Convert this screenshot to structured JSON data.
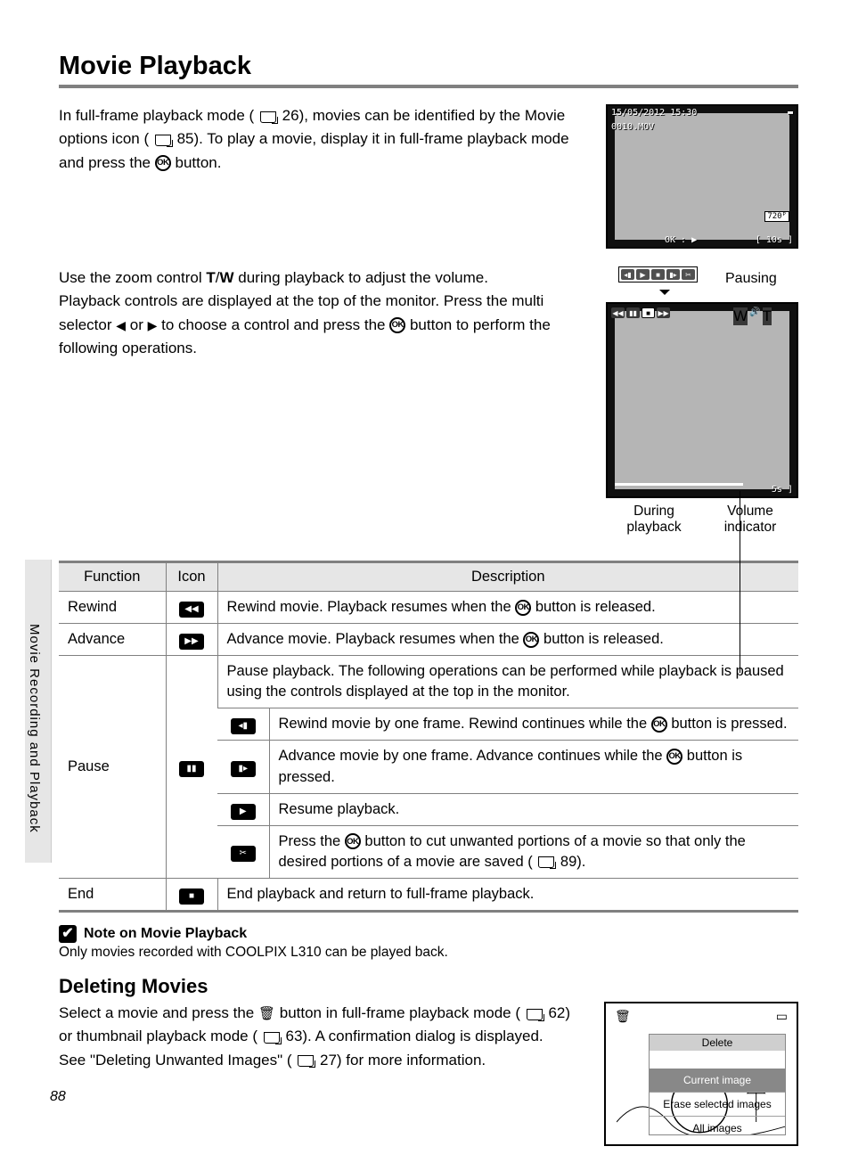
{
  "heading": "Movie Playback",
  "page_number": "88",
  "side_label": "Movie Recording and Playback",
  "intro": {
    "p1a": "In full-frame playback mode (",
    "p1b": " 26), movies can be identified by the Movie options icon (",
    "p1c": " 85). To play a movie, display it in full-frame playback mode and press the ",
    "p1d": " button."
  },
  "zoom": {
    "p2a": "Use the zoom control ",
    "p2b": " during playback to adjust the volume.",
    "p3a": "Playback controls are displayed at the top of the monitor. Press the multi selector ",
    "p3b": " or ",
    "p3c": " to choose a control and press the ",
    "p3d": " button to perform the following operations.",
    "tw_t": "T",
    "tw_slash": "/",
    "tw_w": "W"
  },
  "screen1": {
    "datetime": "15/05/2012 15:30",
    "filename": "0010.MOV",
    "ok_play": "OK : ▶",
    "time_left": "[     10s ]",
    "res": "720ᴾ"
  },
  "screen2": {
    "pausing_label": "Pausing",
    "during_label": "During playback",
    "volume_label": "Volume indicator",
    "time_left": "5s ]"
  },
  "table": {
    "headers": {
      "function": "Function",
      "icon": "Icon",
      "description": "Description"
    },
    "rewind": {
      "fn": "Rewind",
      "desc_a": "Rewind movie. Playback resumes when the ",
      "desc_b": " button is released."
    },
    "advance": {
      "fn": "Advance",
      "desc_a": "Advance movie. Playback resumes when the ",
      "desc_b": " button is released."
    },
    "pause": {
      "fn": "Pause",
      "desc_top": "Pause playback. The following operations can be performed while playback is paused using the controls displayed at the top in the monitor.",
      "frame_rw_a": "Rewind movie by one frame. Rewind continues while the ",
      "frame_rw_b": " button is pressed.",
      "frame_fw_a": "Advance movie by one frame. Advance continues while the ",
      "frame_fw_b": " button is pressed.",
      "resume": "Resume playback.",
      "cut_a": "Press the ",
      "cut_b": " button to cut unwanted portions of a movie so that only the desired portions of a movie are saved (",
      "cut_c": " 89)."
    },
    "end": {
      "fn": "End",
      "desc": "End playback and return to full-frame playback."
    }
  },
  "note": {
    "title": "Note on Movie Playback",
    "body": "Only movies recorded with COOLPIX L310 can be played back."
  },
  "delete": {
    "heading": "Deleting Movies",
    "p1a": "Select a movie and press the ",
    "p1b": " button in full-frame playback mode (",
    "p1c": " 62) or thumbnail playback mode (",
    "p1d": " 63). A confirmation dialog is displayed.",
    "p2a": "See \"Deleting Unwanted Images\" (",
    "p2b": " 27) for more information.",
    "menu_title": "Delete",
    "opt_current": "Current image",
    "opt_erase": "Erase selected images",
    "opt_all": "All images"
  }
}
